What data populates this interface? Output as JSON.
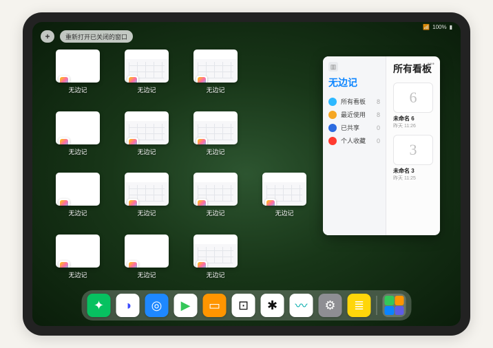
{
  "status": {
    "battery": "100%"
  },
  "topbar": {
    "plus_label": "+",
    "reopen_label": "重新打开已关闭的窗口"
  },
  "thumbs": {
    "label": "无边记",
    "items": [
      {
        "style": "blank"
      },
      {
        "style": "grid"
      },
      {
        "style": "grid"
      },
      {
        "style": "blank"
      },
      {
        "style": "grid"
      },
      {
        "style": "grid"
      },
      {
        "style": "blank"
      },
      {
        "style": "grid"
      },
      {
        "style": "grid"
      },
      {
        "style": "grid"
      },
      {
        "style": "blank"
      },
      {
        "style": "blank"
      },
      {
        "style": "grid"
      }
    ]
  },
  "panel": {
    "left_title": "无边记",
    "items": [
      {
        "icon": "#2db8ff",
        "label": "所有看板",
        "count": "8"
      },
      {
        "icon": "#f5a623",
        "label": "最近使用",
        "count": "8"
      },
      {
        "icon": "#2c6be0",
        "label": "已共享",
        "count": "0"
      },
      {
        "icon": "#ff3b30",
        "label": "个人收藏",
        "count": "0"
      }
    ],
    "right_title": "所有看板",
    "boards": [
      {
        "glyph": "6",
        "name": "未命名 6",
        "date": "昨天 11:26"
      },
      {
        "glyph": "3",
        "name": "未命名 3",
        "date": "昨天 11:25"
      }
    ]
  },
  "dock": {
    "apps": [
      {
        "name": "wechat",
        "bg": "#07c160",
        "glyph": "✦"
      },
      {
        "name": "quark",
        "bg": "#ffffff",
        "glyph": "◑",
        "fg": "#3b4bff"
      },
      {
        "name": "qqbrowser-hd",
        "bg": "#1e88ff",
        "glyph": "◎"
      },
      {
        "name": "play",
        "bg": "#ffffff",
        "glyph": "▶",
        "fg": "#34c759"
      },
      {
        "name": "books",
        "bg": "#ff9500",
        "glyph": "▭"
      },
      {
        "name": "dice",
        "bg": "#ffffff",
        "glyph": "⊡",
        "fg": "#111"
      },
      {
        "name": "nodes",
        "bg": "#ffffff",
        "glyph": "✱",
        "fg": "#111"
      },
      {
        "name": "freeform",
        "bg": "#ffffff",
        "glyph": "〰",
        "fg": "#0aa"
      },
      {
        "name": "settings",
        "bg": "#8e8e93",
        "glyph": "⚙"
      },
      {
        "name": "notes",
        "bg": "#ffd60a",
        "glyph": "≣",
        "fg": "#fff"
      }
    ],
    "recent": [
      {
        "c": "#34c759"
      },
      {
        "c": "#ff9500"
      },
      {
        "c": "#0a84ff"
      },
      {
        "c": "#5e5ce6"
      }
    ]
  }
}
